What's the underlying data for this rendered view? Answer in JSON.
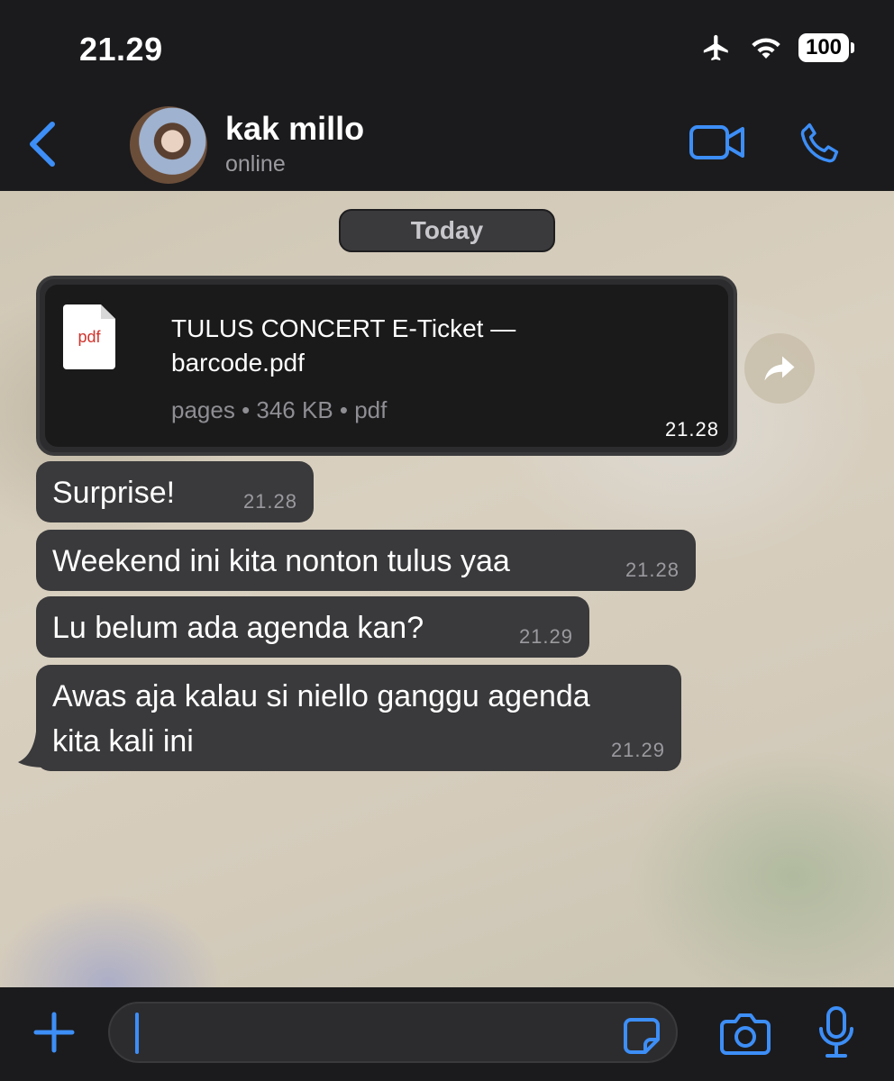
{
  "status_bar": {
    "time": "21.29",
    "battery": "100",
    "icons": [
      "airplane-icon",
      "wifi-icon",
      "battery-icon"
    ]
  },
  "header": {
    "back_icon": "chevron-left-icon",
    "contact_name": "kak millo",
    "contact_status": "online",
    "video_icon": "video-camera-icon",
    "phone_icon": "phone-icon"
  },
  "chat": {
    "date_separator": "Today",
    "file_message": {
      "icon_label": "pdf",
      "file_name_line1": "TULUS CONCERT E-Ticket —",
      "file_name_line2": "barcode.pdf",
      "meta": "pages • 346 KB • pdf",
      "time": "21.28"
    },
    "messages": [
      {
        "text": "Surprise!",
        "time": "21.28"
      },
      {
        "text": "Weekend ini kita nonton tulus yaa",
        "time": "21.28"
      },
      {
        "text": "Lu belum ada agenda kan?",
        "time": "21.29"
      },
      {
        "text_line1": "Awas aja kalau si niello ganggu agenda",
        "text_line2": "kita kali ini",
        "time": "21.29"
      }
    ]
  },
  "input_bar": {
    "icons": [
      "plus-icon",
      "sticker-icon",
      "camera-icon",
      "microphone-icon"
    ]
  },
  "colors": {
    "accent": "#3d8ef7",
    "bubble": "#3a3a3c",
    "bar": "#1b1b1d"
  }
}
